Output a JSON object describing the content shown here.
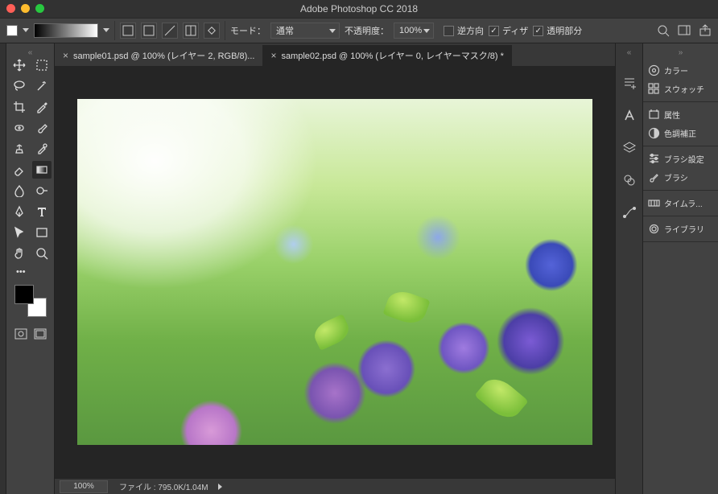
{
  "title": "Adobe Photoshop CC 2018",
  "options": {
    "mode_label": "モード：",
    "mode_value": "通常",
    "opacity_label": "不透明度：",
    "opacity_value": "100%",
    "reverse": "逆方向",
    "dither": "ディザ",
    "transparency": "透明部分"
  },
  "tabs": [
    {
      "label": "sample01.psd @ 100% (レイヤー 2, RGB/8)...",
      "active": false
    },
    {
      "label": "sample02.psd @ 100% (レイヤー 0, レイヤーマスク/8) *",
      "active": true
    }
  ],
  "status": {
    "zoom": "100%",
    "docinfo": "ファイル : 795.0K/1.04M"
  },
  "panels": {
    "g1": [
      {
        "name": "color",
        "label": "カラー"
      },
      {
        "name": "swatches",
        "label": "スウォッチ"
      }
    ],
    "g2": [
      {
        "name": "properties",
        "label": "属性"
      },
      {
        "name": "adjustments",
        "label": "色調補正"
      }
    ],
    "g3": [
      {
        "name": "brush-settings",
        "label": "ブラシ設定"
      },
      {
        "name": "brushes",
        "label": "ブラシ"
      }
    ],
    "g4": [
      {
        "name": "timeline",
        "label": "タイムラ..."
      }
    ],
    "g5": [
      {
        "name": "libraries",
        "label": "ライブラリ"
      }
    ]
  },
  "collapsed_handle": "»",
  "collapsed_handle_r": "«"
}
